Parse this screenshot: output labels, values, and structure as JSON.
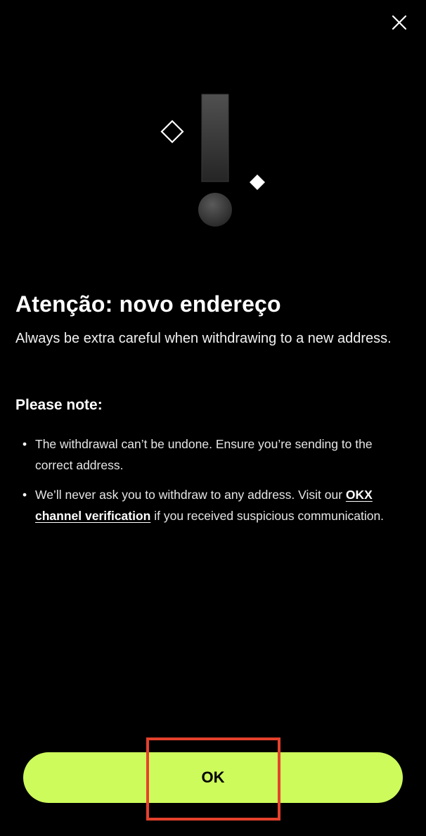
{
  "header": {
    "close_icon": "close-icon"
  },
  "illustration": {
    "icons": [
      "exclamation-icon",
      "diamond-outline-icon",
      "diamond-filled-icon"
    ]
  },
  "main": {
    "title": "Atenção: novo endereço",
    "subtitle": "Always be extra careful when withdrawing to a new address.",
    "note_heading": "Please note:",
    "notes": [
      {
        "bullet": "•",
        "text": "The withdrawal can’t be undone. Ensure you’re sending to the correct address."
      },
      {
        "bullet": "•",
        "text_before": "We’ll never ask you to withdraw to any address. Visit our ",
        "link": "OKX channel verification",
        "text_after": " if you received suspicious communication."
      }
    ]
  },
  "footer": {
    "ok_label": "OK"
  },
  "colors": {
    "background": "#000000",
    "accent": "#cdfb5c",
    "highlight": "#e5412d",
    "text": "#ffffff"
  }
}
